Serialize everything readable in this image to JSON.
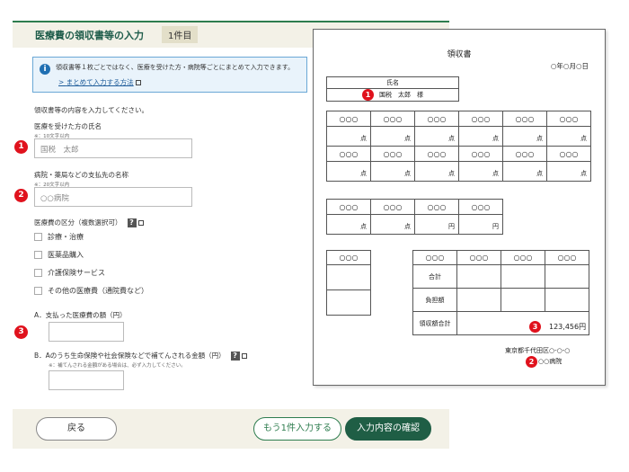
{
  "form": {
    "title": "医療費の領収書等の入力",
    "badge": "1件目",
    "info": {
      "text": "領収書等１枚ごとではなく、医療を受けた方・病院等ごとにまとめて入力できます。",
      "link": "まとめて入力する方法"
    },
    "instructions": "領収書等の内容を入力してください。",
    "patient": {
      "marker": "1",
      "label": "医療を受けた方の氏名",
      "note": "※：10文字以内",
      "value": "国税　太郎"
    },
    "hospital": {
      "marker": "2",
      "label": "病院・薬局などの支払先の名称",
      "note": "※：20文字以内",
      "value": "○○病院"
    },
    "category": {
      "label": "医療費の区分（複数選択可）",
      "help": "?",
      "options": [
        "診療・治療",
        "医薬品購入",
        "介護保険サービス",
        "その他の医療費（通院費など）"
      ]
    },
    "amount_paid": {
      "marker": "3",
      "label": "A．支払った医療費の額（円）"
    },
    "reimbursed": {
      "label": "B．Aのうち生命保険や社会保険などで補てんされる金額（円）",
      "help": "?",
      "note": "※：補てんされる金額がある場合は、必ず入力してください。"
    },
    "buttons": {
      "back": "戻る",
      "add_another": "もう1件入力する",
      "confirm": "入力内容の確認"
    }
  },
  "receipt": {
    "title": "領収書",
    "date": "○年○月○日",
    "name_label": "氏名",
    "name_marker": "1",
    "name_value": "国税　太郎　様",
    "cell_header": "○○○",
    "unit_points": "点",
    "unit_yen": "円",
    "total_rows": [
      "合計",
      "負担額",
      "領収額合計"
    ],
    "amount_marker": "3",
    "amount": "123,456円",
    "issuer_address": "東京都千代田区○-○-○",
    "issuer_marker": "2",
    "issuer_name": "○○病院"
  },
  "colors": {
    "accent_green": "#1f5e45",
    "marker_red": "#e0121d",
    "info_blue": "#1f6fb2",
    "header_beige": "#f3f1e7"
  }
}
